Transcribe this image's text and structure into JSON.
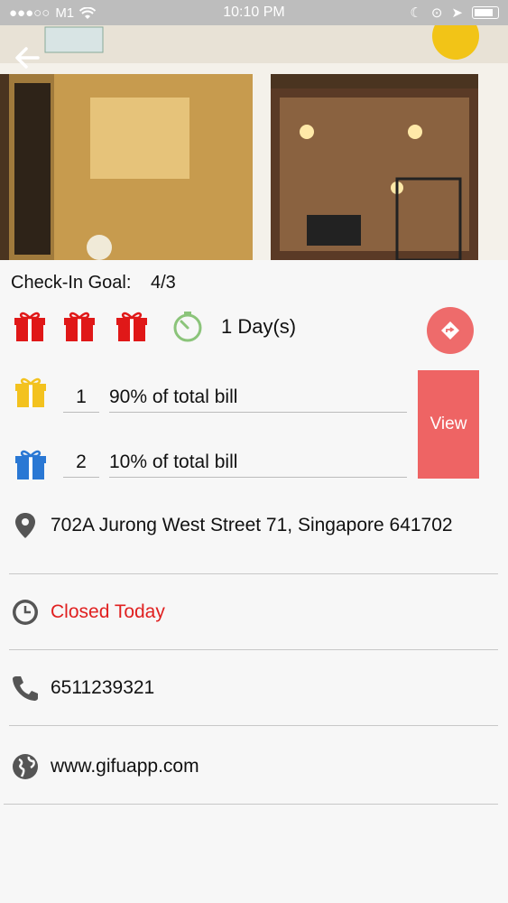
{
  "status_bar": {
    "carrier": "M1",
    "time": "10:10 PM"
  },
  "checkin": {
    "label": "Check-In Goal:",
    "value": "4/3",
    "duration": "1 Day(s)"
  },
  "rewards": [
    {
      "number": "1",
      "text": "90% of total bill",
      "icon": "gift-icon-yellow"
    },
    {
      "number": "2",
      "text": "10% of total bill",
      "icon": "gift-icon-blue"
    }
  ],
  "view_label": "View",
  "info": {
    "address": "702A Jurong West Street 71, Singapore 641702",
    "hours": "Closed Today",
    "phone": "6511239321",
    "website": "www.gifuapp.com"
  },
  "colors": {
    "accent": "#ee6464",
    "closed": "#e02020",
    "gift_red": "#e01818",
    "gift_yellow": "#f3c21f",
    "gift_blue": "#2a78d4",
    "timer": "#8bc47a"
  }
}
